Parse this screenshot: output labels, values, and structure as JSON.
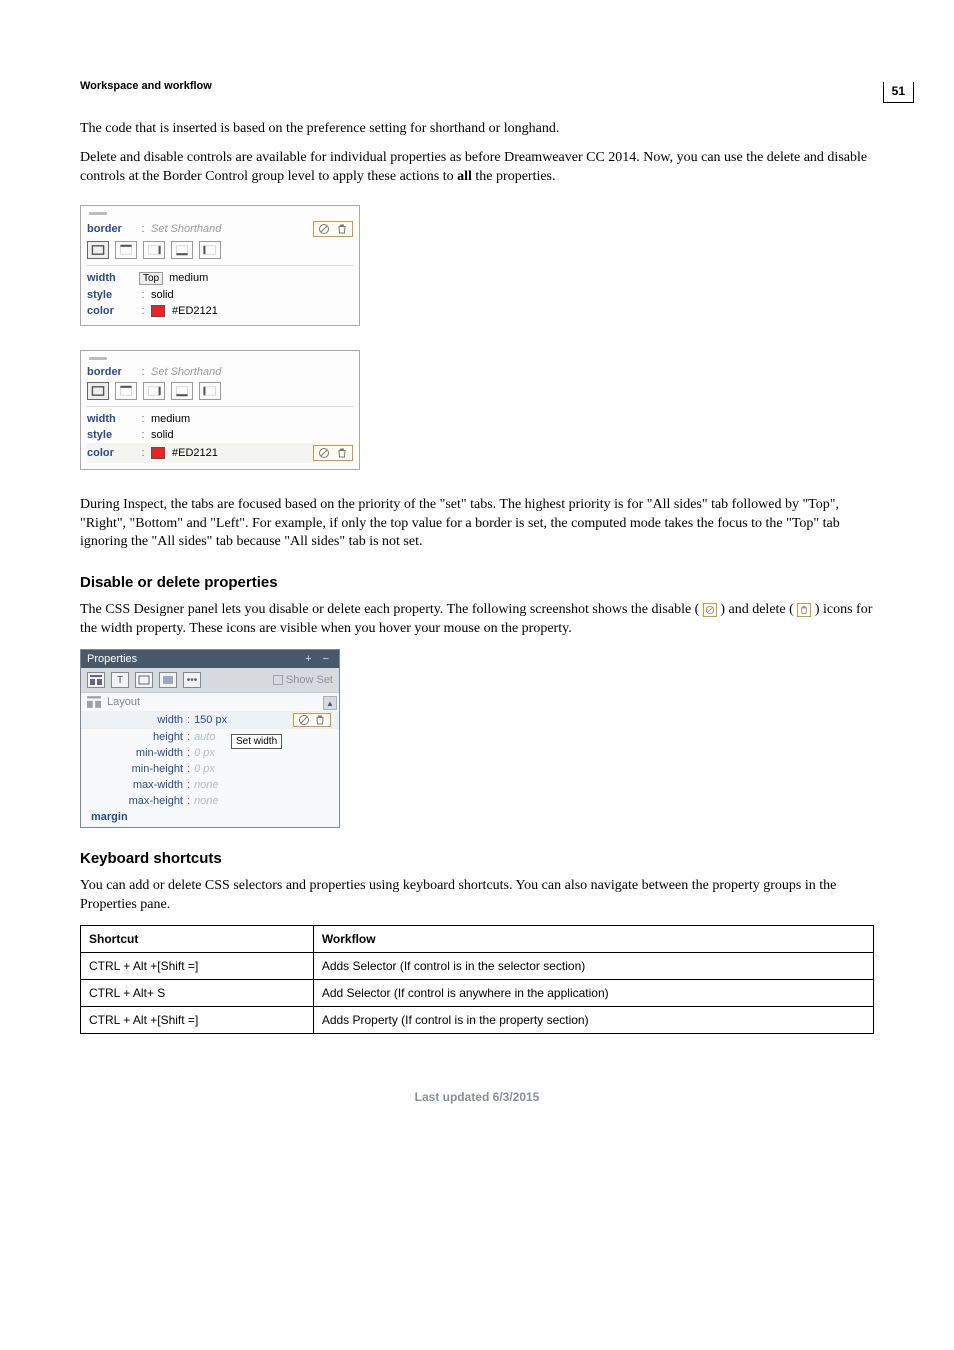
{
  "page_number": "51",
  "breadcrumb": "Workspace and workflow",
  "para1": "The code that is inserted is based on the preference setting for shorthand or longhand.",
  "para2_a": "Delete and disable controls are available for individual properties as before Dreamweaver CC 2014. Now, you can use the delete and disable controls at the Border Control group level to apply these actions to ",
  "para2_bold": "all",
  "para2_b": " the properties.",
  "border_panel": {
    "label": "border",
    "shorthand_placeholder": "Set Shorthand",
    "top_badge": "Top",
    "width_label": "width",
    "width_value": "medium",
    "style_label": "style",
    "style_value": "solid",
    "color_label": "color",
    "color_value": "#ED2121"
  },
  "para3": "During Inspect, the tabs are focused based on the priority of the \"set\" tabs. The highest priority is for \"All sides\" tab followed by \"Top\", \"Right\", \"Bottom\" and \"Left\". For example, if only the top value for a border is set, the computed mode takes the focus to the \"Top\" tab ignoring the \"All sides\" tab because \"All sides\" tab is not set.",
  "h_disable": "Disable or delete properties",
  "para4_a": "The CSS Designer panel lets you disable or delete each property. The following screenshot shows the disable (",
  "para4_b": ") and delete (",
  "para4_c": ") icons for the width property. These icons are visible when you hover your mouse on the property.",
  "props": {
    "title": "Properties",
    "show_set": "Show Set",
    "layout_label": "Layout",
    "tooltip": "Set width",
    "rows": {
      "width": {
        "name": "width",
        "value": "150 px"
      },
      "height": {
        "name": "height",
        "value": "auto"
      },
      "minwidth": {
        "name": "min-width",
        "value": "0 px"
      },
      "minheight": {
        "name": "min-height",
        "value": "0 px"
      },
      "maxwidth": {
        "name": "max-width",
        "value": "none"
      },
      "maxheight": {
        "name": "max-height",
        "value": "none"
      }
    },
    "margin_label": "margin"
  },
  "h_shortcuts": "Keyboard shortcuts",
  "para5": "You can add or delete CSS selectors and properties using keyboard shortcuts. You can also navigate between the property groups in the Properties pane.",
  "table": {
    "head": {
      "c1": "Shortcut",
      "c2": "Workflow"
    },
    "rows": [
      {
        "c1": "CTRL + Alt +[Shift =]",
        "c2": "Adds Selector (If control is in the selector section)"
      },
      {
        "c1": "CTRL + Alt+ S",
        "c2": "Add Selector (If control is anywhere in the application)"
      },
      {
        "c1": "CTRL + Alt +[Shift =]",
        "c2": "Adds Property (If control is in the property section)"
      }
    ]
  },
  "footer": "Last updated 6/3/2015"
}
